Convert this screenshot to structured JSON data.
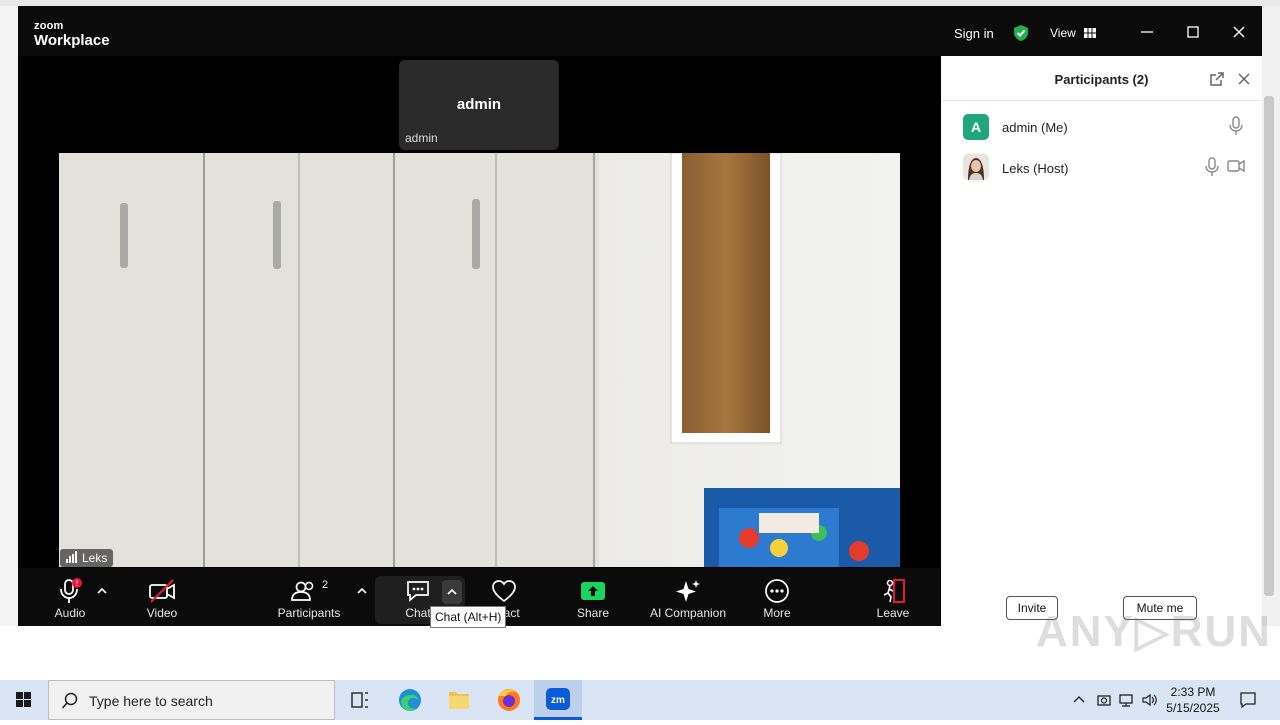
{
  "window": {
    "brand_small": "zoom",
    "brand_big": "Workplace",
    "sign_in": "Sign in",
    "view": "View"
  },
  "thumbnail": {
    "name": "admin",
    "label": "admin"
  },
  "video": {
    "label": "Leks"
  },
  "toolbar": {
    "audio": "Audio",
    "audio_badge": "!",
    "video": "Video",
    "participants": "Participants",
    "participants_count": "2",
    "chat": "Chat",
    "react": "React",
    "share": "Share",
    "ai": "AI Companion",
    "more": "More",
    "leave": "Leave",
    "tooltip": "Chat (Alt+H)"
  },
  "panel": {
    "title": "Participants (2)",
    "participants": [
      {
        "initial": "A",
        "name": "admin (Me)"
      },
      {
        "name": "Leks (Host)"
      }
    ],
    "invite": "Invite",
    "mute_me": "Mute me"
  },
  "taskbar": {
    "search_placeholder": "Type here to search",
    "zoom_app": "zm",
    "time": "2:33 PM",
    "date": "5/15/2025"
  },
  "colors": {
    "accent": "#0b5cd7",
    "share_green": "#1ad45d",
    "avatar_green": "#1fa67a",
    "alert_red": "#e8173a"
  }
}
